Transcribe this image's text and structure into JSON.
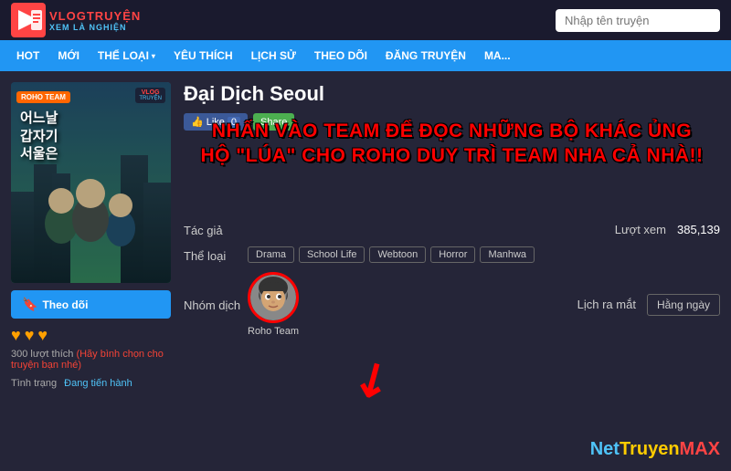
{
  "header": {
    "logo_line1": "VLOGTRUYỆN",
    "logo_line2": "XEM LÀ NGHIỆN",
    "search_placeholder": "Nhập tên truyện"
  },
  "nav": {
    "items": [
      {
        "label": "HOT",
        "has_arrow": false
      },
      {
        "label": "MỚI",
        "has_arrow": false
      },
      {
        "label": "THỂ LOẠI",
        "has_arrow": true
      },
      {
        "label": "YÊU THÍCH",
        "has_arrow": false
      },
      {
        "label": "LỊCH SỬ",
        "has_arrow": false
      },
      {
        "label": "THEO DÕI",
        "has_arrow": false
      },
      {
        "label": "ĐĂNG TRUYỆN",
        "has_arrow": false
      },
      {
        "label": "MA...",
        "has_arrow": false
      }
    ]
  },
  "manga": {
    "title": "Đại Dịch Seoul",
    "cover_text_team": "ROHO TEAM",
    "cover_kr_line1": "어느날",
    "cover_kr_line2": "갑자기",
    "cover_kr_line3": "서울은",
    "like_count": "0",
    "share_label": "Share",
    "overlay_line1": "NHẤN VÀO TEAM ĐỂ ĐỌC NHỮNG BỘ KHÁC ỦNG",
    "overlay_line2": "HỘ \"LÚA\" CHO ROHO DUY TRÌ TEAM NHA CẢ NHÀ!!",
    "author_label": "Tác giả",
    "author_value": "",
    "genre_label": "Thể loại",
    "genres": [
      "Drama",
      "School Life",
      "Webtoon",
      "Horror",
      "Manhwa"
    ],
    "translator_label": "Nhóm dịch",
    "translator_name": "Roho Team",
    "views_label": "Lượt xem",
    "views_value": "385,139",
    "release_label": "Lịch ra mắt",
    "release_value": "Hằng ngày",
    "follow_label": "Theo dõi",
    "hearts": [
      "♥",
      "♥",
      "♥"
    ],
    "likes_text": "300 lượt thích",
    "likes_note": "(Hãy bình chọn cho truyện bạn nhé)",
    "status_label": "Tình trạng",
    "status_value": "Đang tiến hành",
    "watermark": "NetTruyenMAX"
  }
}
